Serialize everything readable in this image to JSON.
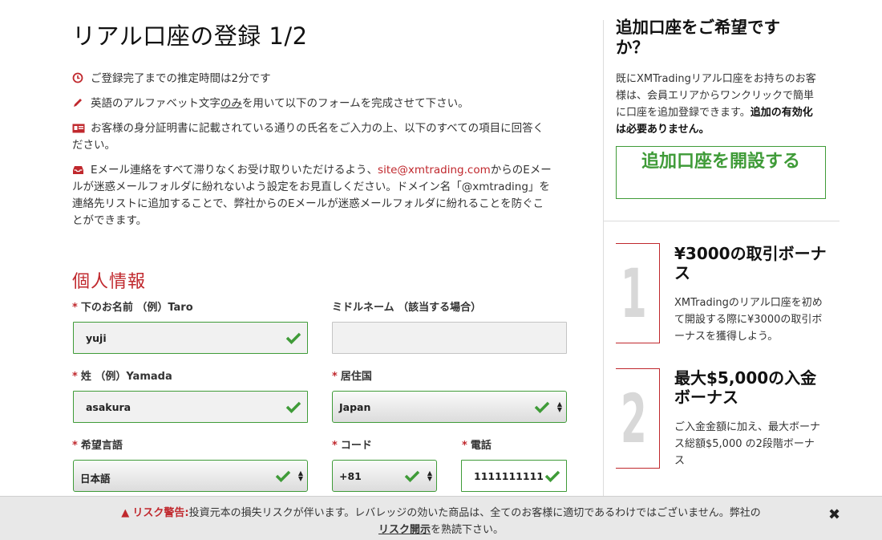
{
  "page": {
    "title": "リアル口座の登録 1/2"
  },
  "info": {
    "time": "ご登録完了までの推定時間は2分です",
    "alphabet_pre": "英語のアルファベット文字",
    "alphabet_only": "のみ",
    "alphabet_post": "を用いて以下のフォームを完成させて下さい。",
    "name_line1": "お客様の身分証明書に記載されている通りの氏名をご入力の上、以下のすべての項目に回答く",
    "name_line2": "ださい。",
    "email_pre": "Eメール連絡をすべて滞りなくお受け取りいただけるよう、",
    "email_addr": "site@xmtrading.com",
    "email_mid": "からのEメー",
    "email_line2": "ルが迷惑メールフォルダに紛れないよう設定をお見直しください。ドメイン名「@xmtrading」を",
    "email_line3": "連絡先リストに追加することで、弊社からのEメールが迷惑メールフォルダに紛れることを防ぐこ",
    "email_line4": "とができます。"
  },
  "section": {
    "title": "個人情報"
  },
  "form": {
    "first_name": {
      "label": "下のお名前 （例）Taro",
      "value": "yuji"
    },
    "middle_name": {
      "label": "ミドルネーム （該当する場合）",
      "value": ""
    },
    "last_name": {
      "label": "姓 （例）Yamada",
      "value": "asakura"
    },
    "country": {
      "label": "居住国",
      "value": "Japan"
    },
    "language": {
      "label": "希望言語",
      "value": "日本語"
    },
    "code": {
      "label": "コード",
      "value": "+81"
    },
    "phone": {
      "label": "電話",
      "value": "1111111111"
    },
    "required_mark": "*"
  },
  "sidebar": {
    "title": "追加口座をご希望ですか？",
    "desc_plain": "既にXMTradingリアル口座をお持ちのお客様は、会員エリアからワンクリックで簡単に口座を追加登録できます。",
    "desc_bold": "追加の有効化は必要ありません。",
    "button": "追加口座を開設する",
    "promos": [
      {
        "num": "1",
        "title": "¥3000の取引ボーナス",
        "desc": "XMTradingのリアル口座を初めて開設する際に¥3000の取引ボーナスを獲得しよう。"
      },
      {
        "num": "2",
        "title": "最大$5,000の入金ボーナス",
        "desc": "ご入金金額に加え、最大ボーナス総額$5,000 の2段階ボーナス"
      }
    ]
  },
  "risk": {
    "warn": "リスク警告:",
    "text1": "投資元本の損失リスクが伴います。レバレッジの効いた商品は、全てのお客様に適切であるわけではございません。弊社の",
    "link": "リスク開示",
    "text2": "を熟読下さい。",
    "close": "✖"
  },
  "colors": {
    "accent_red": "#c0282d",
    "valid_green": "#3f9b38"
  }
}
